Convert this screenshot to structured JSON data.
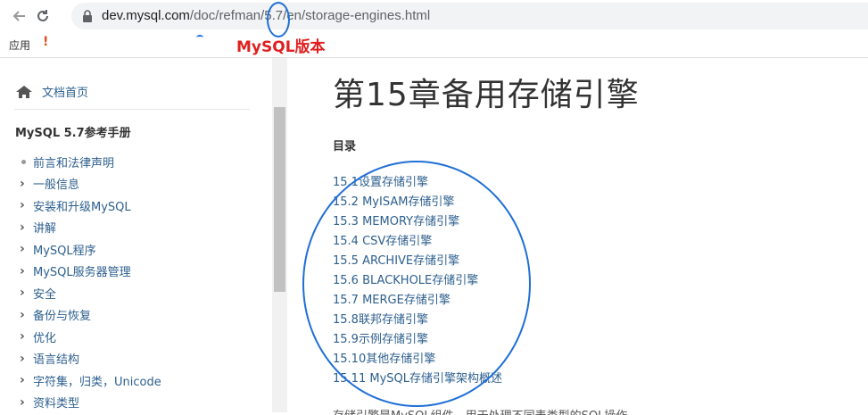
{
  "browser": {
    "url_host": "dev.mysql.com",
    "url_path": "/doc/refman/5.7/en/storage-engines.html",
    "apps_label": "应用",
    "bookmark_marker": "!"
  },
  "annotation": {
    "label": "MySQL版本",
    "color": "#e01f1f",
    "circle_color": "#1f6fd6"
  },
  "sidebar": {
    "home_label": "文档首页",
    "manual_title": "MySQL 5.7参考手册",
    "items": [
      {
        "label": "前言和法律声明",
        "marker": "dot"
      },
      {
        "label": "一般信息",
        "marker": "chevron"
      },
      {
        "label": "安装和升级MySQL",
        "marker": "chevron"
      },
      {
        "label": "讲解",
        "marker": "chevron"
      },
      {
        "label": "MySQL程序",
        "marker": "chevron"
      },
      {
        "label": "MySQL服务器管理",
        "marker": "chevron"
      },
      {
        "label": "安全",
        "marker": "chevron"
      },
      {
        "label": "备份与恢复",
        "marker": "chevron"
      },
      {
        "label": "优化",
        "marker": "chevron"
      },
      {
        "label": "语言结构",
        "marker": "chevron"
      },
      {
        "label": "字符集，归类，Unicode",
        "marker": "chevron"
      },
      {
        "label": "资料类型",
        "marker": "chevron"
      }
    ]
  },
  "main": {
    "title": "第15章备用存储引擎",
    "toc_heading": "目录",
    "toc": [
      "15.1设置存储引擎",
      "15.2 MyISAM存储引擎",
      "15.3 MEMORY存储引擎",
      "15.4 CSV存储引擎",
      "15.5 ARCHIVE存储引擎",
      "15.6 BLACKHOLE存储引擎",
      "15.7 MERGE存储引擎",
      "15.8联邦存储引擎",
      "15.9示例存储引擎",
      "15.10其他存储引擎",
      "15.11 MySQL存储引擎架构概述"
    ],
    "body_cut": "存储引擎是MySQL组件，用于处理不同表类型的SQL操作。"
  }
}
